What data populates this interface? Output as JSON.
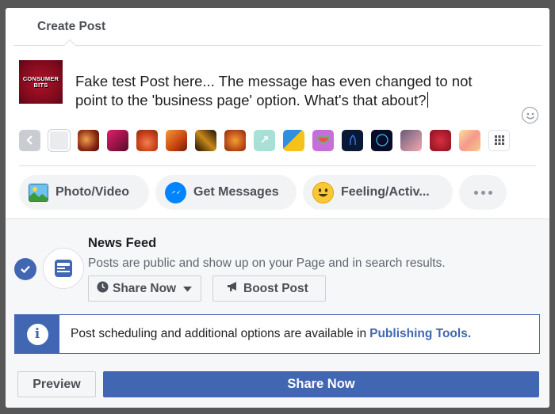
{
  "dialog": {
    "title": "Create Post"
  },
  "composer": {
    "avatar_text": [
      "CONSUMER",
      "BITS"
    ],
    "message": "Fake test Post here...  The message has even changed to not point to the 'business page' option. What's that about?",
    "emoji_icon": "smiley-icon",
    "backgrounds": [
      {
        "name": "prev-arrow",
        "color": "#c9ccd1"
      },
      {
        "name": "plain-white",
        "color": "#e9ebee"
      },
      {
        "name": "warm-lights",
        "color": "#8a2a12"
      },
      {
        "name": "pink-gradient",
        "color": "#b0123f"
      },
      {
        "name": "orange-leaves",
        "color": "#c9431a"
      },
      {
        "name": "orange-fire",
        "color": "#e0641b"
      },
      {
        "name": "dark-gold",
        "color": "#4a2a0a"
      },
      {
        "name": "autumn-orange",
        "color": "#c0501c"
      },
      {
        "name": "mint",
        "color": "#a8e0d5"
      },
      {
        "name": "blue-yellow",
        "color": "#2f8fe0"
      },
      {
        "name": "watermelon",
        "color": "#c66fd8"
      },
      {
        "name": "night-blue",
        "color": "#0a1838"
      },
      {
        "name": "dark-circle",
        "color": "#0a0a2a"
      },
      {
        "name": "pink-pattern",
        "color": "#5a4a6a"
      },
      {
        "name": "red-pattern",
        "color": "#a8182a"
      },
      {
        "name": "swirl",
        "color": "#f7c88a"
      },
      {
        "name": "grid-more",
        "color": "#ffffff"
      }
    ]
  },
  "actions": {
    "photo": "Photo/Video",
    "messages": "Get Messages",
    "feeling": "Feeling/Activ..."
  },
  "news_feed": {
    "title": "News Feed",
    "description": "Posts are public and show up on your Page and in search results.",
    "share_now_label": "Share Now",
    "boost_label": "Boost Post"
  },
  "info": {
    "text": "Post scheduling and additional options are available in",
    "link": "Publishing Tools."
  },
  "footer": {
    "preview_label": "Preview",
    "share_label": "Share Now"
  },
  "colors": {
    "accent": "#4267b2",
    "messenger": "#0084ff",
    "feeling": "#f7b928"
  }
}
